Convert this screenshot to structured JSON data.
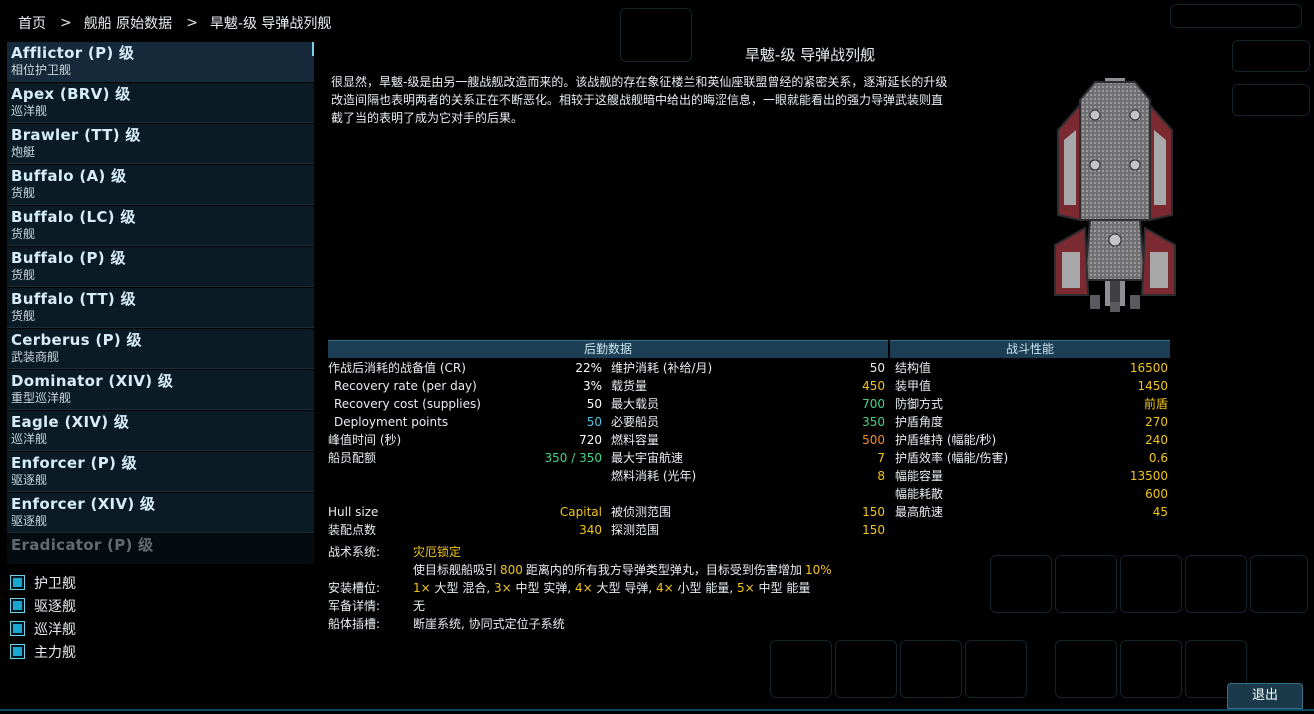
{
  "breadcrumb": [
    "首页",
    "舰船 原始数据",
    "旱魃-级 导弹战列舰"
  ],
  "ships": [
    {
      "name": "Afflictor (P) 级",
      "sub": "相位护卫舰"
    },
    {
      "name": "Apex (BRV) 级",
      "sub": "巡洋舰"
    },
    {
      "name": "Brawler (TT) 级",
      "sub": "炮艇"
    },
    {
      "name": "Buffalo (A) 级",
      "sub": "货舰"
    },
    {
      "name": "Buffalo (LC) 级",
      "sub": "货舰"
    },
    {
      "name": "Buffalo (P) 级",
      "sub": "货舰"
    },
    {
      "name": "Buffalo (TT) 级",
      "sub": "货舰"
    },
    {
      "name": "Cerberus (P) 级",
      "sub": "武装商舰"
    },
    {
      "name": "Dominator (XIV) 级",
      "sub": "重型巡洋舰"
    },
    {
      "name": "Eagle (XIV) 级",
      "sub": "巡洋舰"
    },
    {
      "name": "Enforcer (P) 级",
      "sub": "驱逐舰"
    },
    {
      "name": "Enforcer (XIV) 级",
      "sub": "驱逐舰"
    },
    {
      "name": "Eradicator (P) 级",
      "sub": ""
    }
  ],
  "filters": [
    "护卫舰",
    "驱逐舰",
    "巡洋舰",
    "主力舰"
  ],
  "detail": {
    "title": "旱魃-级 导弹战列舰",
    "description": "很显然，旱魃-级是由另一艘战舰改造而来的。该战舰的存在象征楼兰和英仙座联盟曾经的紧密关系，逐渐延长的升级改造间隔也表明两者的关系正在不断恶化。相较于这艘战舰暗中给出的晦涩信息，一眼就能看出的强力导弹武装则直截了当的表明了成为它对手的后果。"
  },
  "logistics": {
    "header": "后勤数据",
    "left": [
      {
        "label": "作战后消耗的战备值 (CR)",
        "value": "22%",
        "color": "#e8eef0"
      },
      {
        "label": "Recovery rate (per day)",
        "value": "3%",
        "color": "#e8eef0"
      },
      {
        "label": "Recovery cost (supplies)",
        "value": "50",
        "color": "#e8eef0"
      },
      {
        "label": "Deployment points",
        "value": "50",
        "color": "#4ec3e6"
      },
      {
        "label": "峰值时间 (秒)",
        "value": "720",
        "color": "#e8eef0"
      },
      {
        "label": "船员配额",
        "value": "350 / 350",
        "color": "#3fd68a"
      },
      {
        "label": "",
        "value": "",
        "color": "#e8eef0"
      },
      {
        "label": "Hull size",
        "value": "Capital",
        "color": "#f2c618"
      },
      {
        "label": "装配点数",
        "value": "340",
        "color": "#f2c618"
      }
    ],
    "right": [
      {
        "label": "维护消耗 (补给/月)",
        "value": "50",
        "color": "#e8eef0"
      },
      {
        "label": "载货量",
        "value": "450",
        "color": "#f2c618"
      },
      {
        "label": "最大载员",
        "value": "700",
        "color": "#3fd68a"
      },
      {
        "label": "必要船员",
        "value": "350",
        "color": "#3fd68a"
      },
      {
        "label": "燃料容量",
        "value": "500",
        "color": "#f58a2c"
      },
      {
        "label": "最大宇宙航速",
        "value": "7",
        "color": "#f2c618"
      },
      {
        "label": "燃料消耗 (光年)",
        "value": "8",
        "color": "#f2c618"
      },
      {
        "label": "被侦测范围",
        "value": "150",
        "color": "#f2c618"
      },
      {
        "label": "探测范围",
        "value": "150",
        "color": "#f2c618"
      }
    ]
  },
  "combat": {
    "header": "战斗性能",
    "rows": [
      {
        "label": "结构值",
        "value": "16500"
      },
      {
        "label": "装甲值",
        "value": "1450"
      },
      {
        "label": "防御方式",
        "value": "前盾"
      },
      {
        "label": "护盾角度",
        "value": "270"
      },
      {
        "label": "护盾维持 (幅能/秒)",
        "value": "240"
      },
      {
        "label": "护盾效率 (幅能/伤害)",
        "value": "0.6"
      },
      {
        "label": "幅能容量",
        "value": "13500"
      },
      {
        "label": "幅能耗散",
        "value": "600"
      },
      {
        "label": "最高航速",
        "value": "45"
      }
    ]
  },
  "tactical": {
    "system_label": "战术系统:",
    "system_name": "灾厄锁定",
    "system_desc_1": "使目标舰船吸引",
    "system_desc_num1": "800",
    "system_desc_2": "距离内的所有我方导弹类型弹丸，目标受到伤害增加",
    "system_desc_num2": "10%",
    "slots_label": "安装槽位:",
    "slots": [
      {
        "count": "1×",
        "text": "大型 混合,"
      },
      {
        "count": "3×",
        "text": "中型 实弹,"
      },
      {
        "count": "4×",
        "text": "大型 导弹,"
      },
      {
        "count": "4×",
        "text": "小型 能量,"
      },
      {
        "count": "5×",
        "text": "中型 能量"
      }
    ],
    "armaments_label": "军备详情:",
    "armaments_value": "无",
    "hullmods_label": "船体插槽:",
    "hullmods_value": "断崖系统, 协同式定位子系统"
  },
  "exit_label": "退出"
}
